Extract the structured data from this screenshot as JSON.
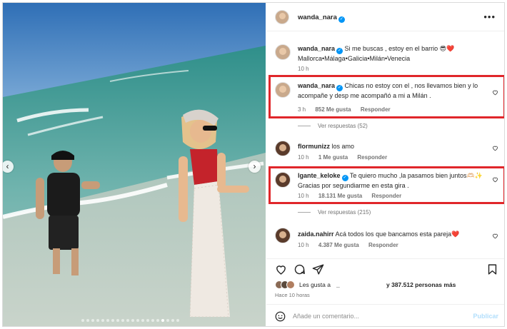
{
  "header": {
    "username": "wanda_nara",
    "more_icon": "more-horizontal-icon"
  },
  "caption": {
    "username": "wanda_nara",
    "text": "Si me buscas , estoy en el barrio 😎❤️ Mallorca•Málaga•Galicia•Milán•Venecia",
    "time": "10 h"
  },
  "comments": [
    {
      "username": "wanda_nara",
      "verified": true,
      "text": "Chicas no estoy con el , nos llevamos bien y lo acompañe y desp me acompañó a mi a Milán .",
      "time": "3 h",
      "likes": "852 Me gusta",
      "reply": "Responder",
      "view_replies": "Ver respuestas (52)"
    },
    {
      "username": "flormunizz",
      "verified": false,
      "text": "los amo",
      "time": "10 h",
      "likes": "1 Me gusta",
      "reply": "Responder"
    },
    {
      "username": "lgante_keloke",
      "verified": true,
      "text": "Te quiero mucho ,la pasamos bien juntos🫶🏻✨ Gracias por segundiarme en esta gira .",
      "time": "10 h",
      "likes": "18.131 Me gusta",
      "reply": "Responder",
      "view_replies": "Ver respuestas (215)"
    },
    {
      "username": "zaida.nahirr",
      "verified": false,
      "text": "Acá todos los que bancamos esta pareja❤️",
      "time": "10 h",
      "likes": "4.387 Me gusta",
      "reply": "Responder"
    }
  ],
  "likes_summary": {
    "prefix": "Les gusta a",
    "name": "_",
    "suffix": "y 387.512 personas más"
  },
  "post_time": "Hace 10 horas",
  "add_comment": {
    "placeholder": "Añade un comentario...",
    "post_label": "Publicar"
  },
  "colors": {
    "highlight": "#e0262a",
    "link_blue": "#0095f6",
    "meta_gray": "#737373"
  },
  "icons": [
    "heart-icon",
    "comment-icon",
    "share-icon",
    "bookmark-icon",
    "emoji-icon",
    "verified-icon"
  ]
}
